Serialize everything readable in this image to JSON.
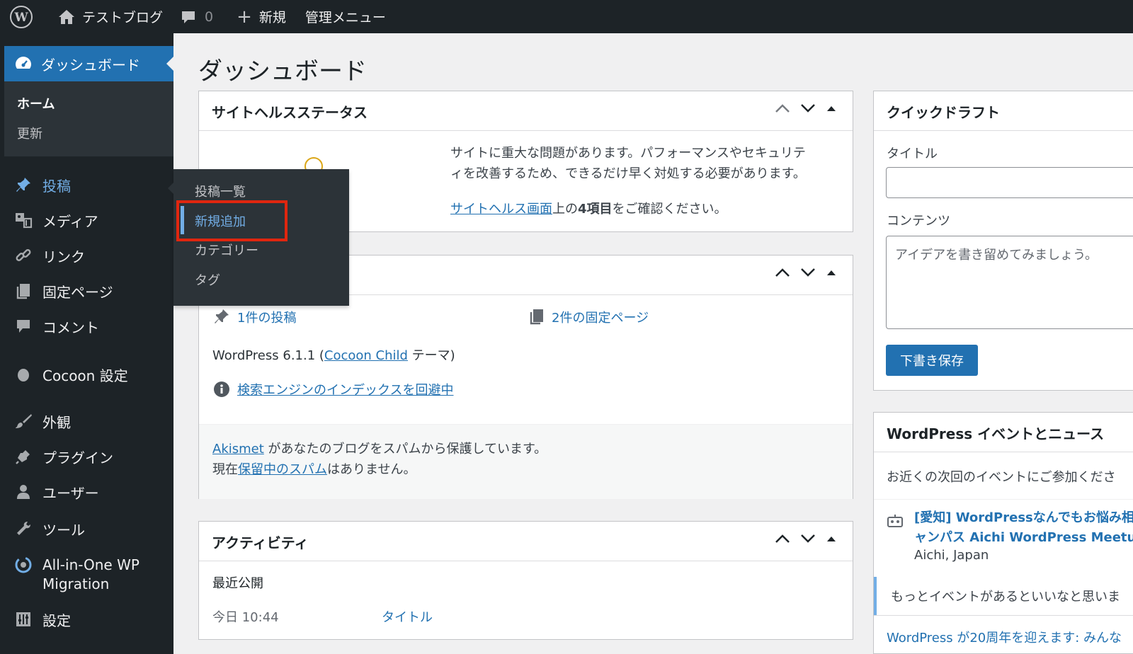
{
  "adminbar": {
    "site_name": "テストブログ",
    "comment_count": "0",
    "new_label": "新規",
    "admin_menu": "管理メニュー"
  },
  "sidebar": {
    "dashboard": "ダッシュボード",
    "sub_home": "ホーム",
    "sub_update": "更新",
    "items": [
      {
        "label": "投稿",
        "icon": "pin-icon"
      },
      {
        "label": "メディア",
        "icon": "media-icon"
      },
      {
        "label": "リンク",
        "icon": "link-icon"
      },
      {
        "label": "固定ページ",
        "icon": "page-icon"
      },
      {
        "label": "コメント",
        "icon": "comment-icon"
      },
      {
        "label": "Cocoon 設定",
        "icon": "circle-icon"
      },
      {
        "label": "外観",
        "icon": "brush-icon"
      },
      {
        "label": "プラグイン",
        "icon": "plug-icon"
      },
      {
        "label": "ユーザー",
        "icon": "user-icon"
      },
      {
        "label": "ツール",
        "icon": "wrench-icon"
      },
      {
        "label": "All-in-One WP",
        "label2": "Migration",
        "icon": "migration-icon"
      },
      {
        "label": "設定",
        "icon": "settings-icon"
      }
    ]
  },
  "flyout": {
    "items": [
      "投稿一覧",
      "新規追加",
      "カテゴリー",
      "タグ"
    ]
  },
  "main": {
    "title": "ダッシュボード",
    "health": {
      "title": "サイトヘルスステータス",
      "line1": "サイトに重大な問題があります。パフォーマンスやセキュリテ",
      "line2": "ィを改善するため、できるだけ早く対処する必要があります。",
      "link": "サイトヘルス画面",
      "suffix1": "上の",
      "bold": "4項目",
      "suffix2": "をご確認ください。"
    },
    "glance": {
      "posts": "1件の投稿",
      "pages": "2件の固定ページ",
      "wp_prefix": "WordPress 6.1.1 (",
      "theme": "Cocoon Child",
      "wp_suffix": " テーマ)",
      "search": "検索エンジンのインデックスを回避中",
      "akismet": "Akismet",
      "akismet_rest": " があなたのブログをスパムから保護しています。",
      "spam_prefix": "現在",
      "spam_link": "保留中のスパム",
      "spam_suffix": "はありません。"
    },
    "activity": {
      "title": "アクティビティ",
      "recent": "最近公開",
      "time": "今日 10:44",
      "post_title": "タイトル"
    },
    "draft": {
      "title": "クイックドラフト",
      "title_label": "タイトル",
      "content_label": "コンテンツ",
      "placeholder": "アイデアを書き留めてみましょう。",
      "save": "下書き保存"
    },
    "events": {
      "title": "WordPress イベントとニュース",
      "intro": "お近くの次回のイベントにご参加くださ",
      "event_line1": "[愛知] WordPressなんでもお悩み相",
      "event_line2": "ャンパス Aichi WordPress Meetup",
      "event_loc": "Aichi, Japan",
      "more": "もっとイベントがあるといいなと思いま",
      "news": "WordPress が20周年を迎えます: みんな"
    }
  },
  "colors": {
    "accent": "#2271b1",
    "highlight": "#e0260f",
    "bar": "#1d2327"
  }
}
